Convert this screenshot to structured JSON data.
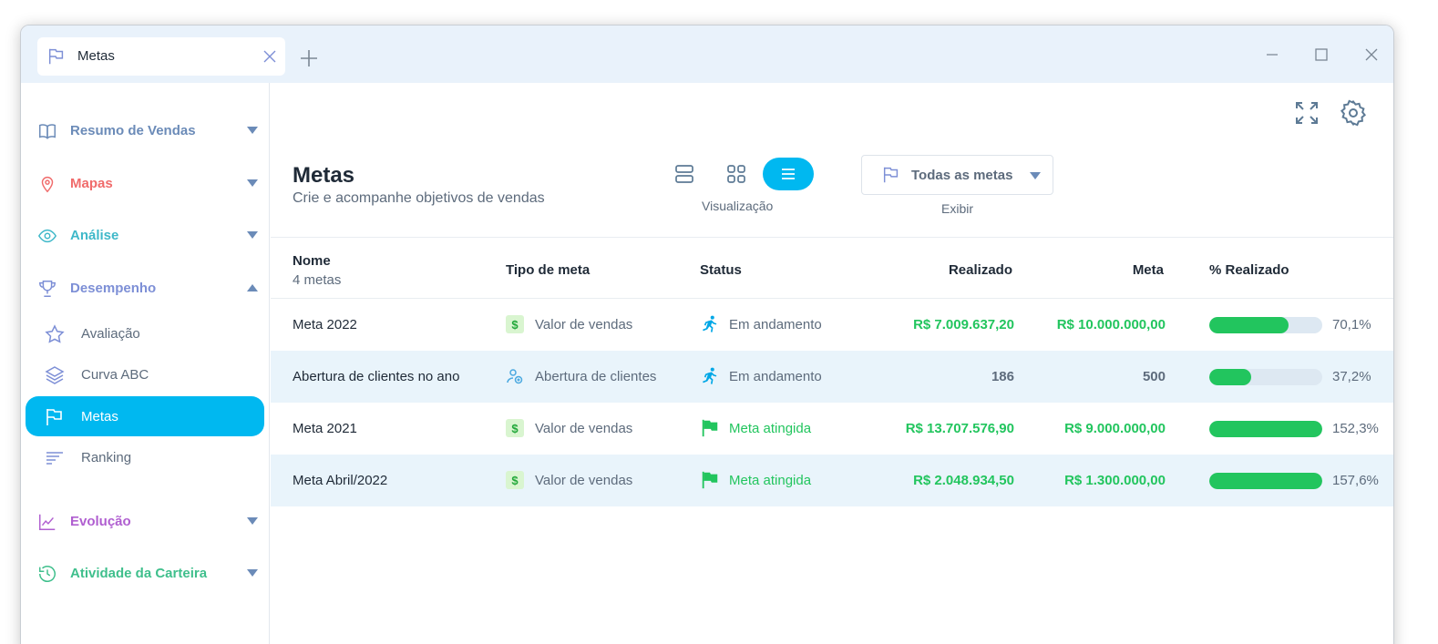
{
  "window": {
    "tab_label": "Metas"
  },
  "sidebar": {
    "groups": [
      {
        "label": "Resumo de Vendas",
        "icon": "book-icon",
        "color": "#6b8bb8",
        "expanded": false
      },
      {
        "label": "Mapas",
        "icon": "map-pin-icon",
        "color": "#f06b6b",
        "expanded": false
      },
      {
        "label": "Análise",
        "icon": "eye-icon",
        "color": "#3fb8c9",
        "expanded": false
      },
      {
        "label": "Desempenho",
        "icon": "trophy-icon",
        "color": "#7d8fd6",
        "expanded": true
      },
      {
        "label": "Evolução",
        "icon": "chart-line-icon",
        "color": "#b05fd0",
        "expanded": false
      },
      {
        "label": "Atividade da Carteira",
        "icon": "history-icon",
        "color": "#3fbf8c",
        "expanded": false
      }
    ],
    "sub_items": [
      {
        "label": "Avaliação",
        "icon": "star-icon",
        "active": false
      },
      {
        "label": "Curva ABC",
        "icon": "layers-icon",
        "active": false
      },
      {
        "label": "Metas",
        "icon": "flag-icon",
        "active": true
      },
      {
        "label": "Ranking",
        "icon": "ranking-icon",
        "active": false
      }
    ]
  },
  "header": {
    "title": "Metas",
    "subtitle": "Crie e acompanhe objetivos de vendas",
    "view_caption": "Visualização",
    "filter_label": "Todas as metas",
    "filter_caption": "Exibir"
  },
  "table": {
    "columns": {
      "name": "Nome",
      "name_count": "4 metas",
      "type": "Tipo de meta",
      "status": "Status",
      "realized": "Realizado",
      "goal": "Meta",
      "pct": "% Realizado"
    },
    "rows": [
      {
        "name": "Meta 2022",
        "type": "Valor de vendas",
        "type_icon": "dollar-icon",
        "status": "Em andamento",
        "status_icon": "running-icon",
        "realized": "R$ 7.009.637,20",
        "goal": "R$ 10.000.000,00",
        "pct": "70,1%",
        "progress": 70.1,
        "money": true,
        "done": false
      },
      {
        "name": "Abertura de clientes no ano",
        "type": "Abertura de clientes",
        "type_icon": "new-client-icon",
        "status": "Em andamento",
        "status_icon": "running-icon",
        "realized": "186",
        "goal": "500",
        "pct": "37,2%",
        "progress": 37.2,
        "money": false,
        "done": false
      },
      {
        "name": "Meta 2021",
        "type": "Valor de vendas",
        "type_icon": "dollar-icon",
        "status": "Meta atingida",
        "status_icon": "flag-icon",
        "realized": "R$ 13.707.576,90",
        "goal": "R$ 9.000.000,00",
        "pct": "152,3%",
        "progress": 100,
        "money": true,
        "done": true
      },
      {
        "name": "Meta Abril/2022",
        "type": "Valor de vendas",
        "type_icon": "dollar-icon",
        "status": "Meta atingida",
        "status_icon": "flag-icon",
        "realized": "R$ 2.048.934,50",
        "goal": "R$ 1.300.000,00",
        "pct": "157,6%",
        "progress": 100,
        "money": true,
        "done": true
      }
    ]
  },
  "colors": {
    "accent": "#00b8f0",
    "success": "#22c55e",
    "track": "#dde8f2"
  }
}
